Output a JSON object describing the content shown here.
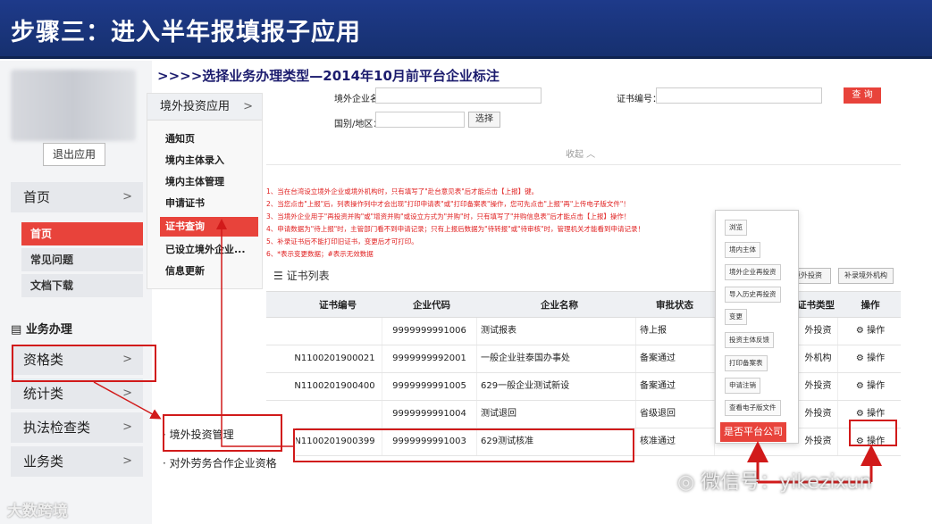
{
  "banner": {
    "title": "步骤三：进入半年报填报子应用"
  },
  "subtitle": ">>>>选择业务办理类型—2014年10月前平台企业标注",
  "left_nav": {
    "logout": "退出应用",
    "home": "首页",
    "sub_items": [
      "首页",
      "常见问题",
      "文档下载"
    ],
    "section": "业务办理",
    "categories": [
      "资格类",
      "统计类",
      "执法检查类",
      "业务类"
    ]
  },
  "mid_nav": {
    "head": "境外投资应用",
    "items": [
      "通知页",
      "境内主体录入",
      "境内主体管理",
      "申请证书",
      "证书查询",
      "已设立境外企业...",
      "信息更新"
    ]
  },
  "search": {
    "company_label": "境外企业名称：",
    "cert_label": "证书编号：",
    "country_label": "国别/地区：",
    "select_btn": "选择",
    "query_btn": "查 询",
    "collapse": "收起 ︿"
  },
  "notes": [
    "1、当在台湾设立境外企业或境外机构时，只有填写了\"赴台意见表\"后才能点击【上报】键。",
    "2、当您点击\"上报\"后，列表操作列中才会出现\"打印申请表\"或\"打印备案表\"操作，您可先点击\"上报\"再\"上传电子版文件\"！",
    "3、当境外企业用于\"再投资并购\"或\"增资并购\"或设立方式为\"并购\"时，只有填写了\"并购信息表\"后才能点击【上报】操作！",
    "4、申请数据为\"待上报\"时，主管部门看不到申请记录；只有上报后数据为\"待转报\"或\"待审核\"时，管理机关才能看到申请记录！",
    "5、补录证书后不能打印旧证书，变更后才可打印。",
    "6、*表示变更数据；#表示无效数据"
  ],
  "list_title": "证书列表",
  "right_buttons": [
    "境外投资",
    "补录境外机构"
  ],
  "table": {
    "headers": [
      "证书编号",
      "企业代码",
      "企业名称",
      "审批状态",
      "证书类型",
      "操作"
    ],
    "rows": [
      [
        "",
        "9999999991006",
        "测试报表",
        "待上报",
        "外投资",
        "操作"
      ],
      [
        "N1100201900021",
        "9999999992001",
        "一般企业驻泰国办事处",
        "备案通过",
        "外机构",
        "操作"
      ],
      [
        "N1100201900400",
        "9999999991005",
        "629一般企业测试新设",
        "备案通过",
        "外投资",
        "操作"
      ],
      [
        "",
        "9999999991004",
        "测试退回",
        "省级退回",
        "外投资",
        "操作"
      ],
      [
        "N1100201900399",
        "9999999991003",
        "629测试核准",
        "核准通过",
        "外投资",
        "操作"
      ]
    ]
  },
  "dropdown": {
    "items": [
      "浏览",
      "境内主体",
      "境外企业再投资",
      "导入历史再投资",
      "变更",
      "投资主体反馈",
      "打印备案表",
      "申请注销",
      "查看电子版文件"
    ],
    "button": "是否平台公司"
  },
  "popup": {
    "items": [
      "境外投资管理",
      "对外劳务合作企业资格"
    ]
  },
  "watermarks": {
    "left": "大数跨境",
    "right": "微信号：yikezixun"
  },
  "colors": {
    "banner": "#1e3a8a",
    "accent_red": "#e8433b",
    "note_red": "#e02020",
    "highlight_red": "#d11a1a"
  }
}
